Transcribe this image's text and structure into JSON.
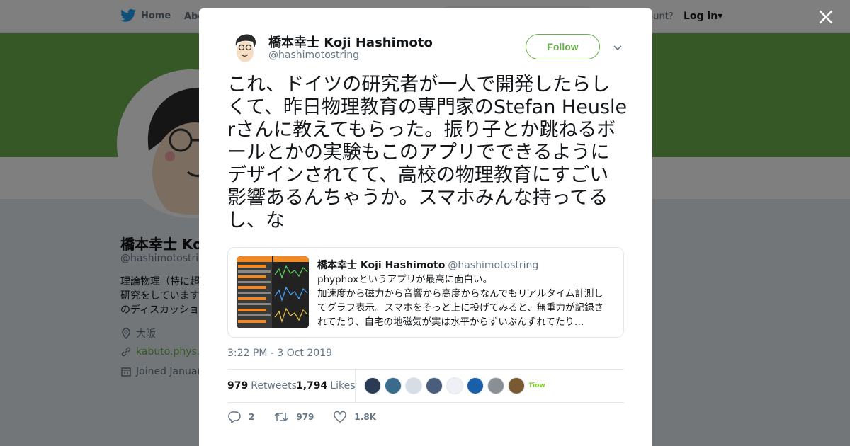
{
  "nav": {
    "home_label": "Home",
    "about_label": "Abo",
    "account_prompt": "ccount?",
    "login_label": "Log in"
  },
  "background_profile": {
    "name": "橋本幸士 Ko",
    "handle": "@hashimotostring",
    "bio_lines": [
      "理論物理（特に超",
      "研究をしています",
      "のディスカッショ"
    ],
    "location": "大阪",
    "url": "kabuto.phys.s",
    "joined": "Joined Januar",
    "banner_color": "#6ab04c"
  },
  "tweet": {
    "author_name": "橋本幸士 Koji Hashimoto",
    "author_handle": "@hashimotostring",
    "follow_label": "Follow",
    "text": "これ、ドイツの研究者が一人で開発したらしくて、昨日物理教育の専門家のStefan Heuslerさんに教えてもらった。振り子とか跳ねるボールとかの実験もこのアプリでできるようにデザインされてて、高校の物理教育にすごい影響あるんちゃうか。スマホみんな持ってるし、な",
    "quote": {
      "author_name": "橋本幸士 Koji Hashimoto",
      "author_handle": "@hashimotostring",
      "lines": [
        "phyphoxというアプリが最高に面白い。",
        "加速度から磁力から音響から高度からなんでもリアルタイム計測し",
        "てグラフ表示。スマホをそっと上に投げてみると、無重力が記録さ",
        "れてたり、自宅の地磁気が実は水平からずいぶんずれてたり…"
      ]
    },
    "timestamp": "3:22 PM - 3 Oct 2019",
    "retweets_count": "979",
    "retweets_label": "Retweets",
    "likes_count": "1,794",
    "likes_label": "Likes",
    "liker_colors": [
      "#2b3a55",
      "#3a6b8a",
      "#d7dde4",
      "#4a5d7a",
      "#eef0f5",
      "#1a5fa8",
      "#8a8f96",
      "#7a5a33",
      "#ffffff"
    ],
    "liker_last_text": "Tiow!e",
    "reply_count": "2",
    "retweet_action_count": "979",
    "like_action_count": "1.8K",
    "accent_color": "#6ab04c"
  }
}
